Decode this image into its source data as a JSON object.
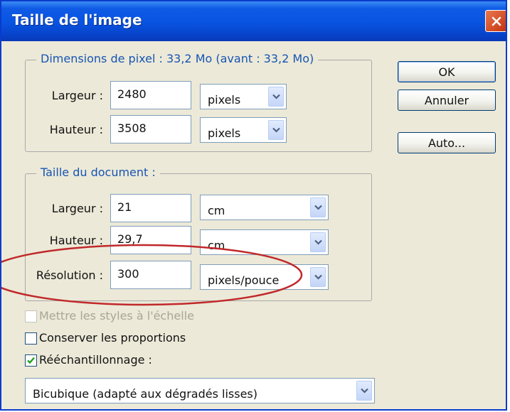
{
  "window": {
    "title": "Taille de l'image"
  },
  "pixel_dimensions": {
    "legend": "Dimensions de pixel :  33,2 Mo (avant : 33,2 Mo)",
    "width": {
      "label": "Largeur :",
      "value": "2480",
      "unit": "pixels"
    },
    "height": {
      "label": "Hauteur :",
      "value": "3508",
      "unit": "pixels"
    }
  },
  "document_size": {
    "legend": "Taille du document :",
    "width": {
      "label": "Largeur :",
      "value": "21",
      "unit": "cm"
    },
    "height": {
      "label": "Hauteur :",
      "value": "29,7",
      "unit": "cm"
    },
    "resolution": {
      "label": "Résolution :",
      "value": "300",
      "unit": "pixels/pouce"
    }
  },
  "buttons": {
    "ok": "OK",
    "cancel": "Annuler",
    "auto": "Auto..."
  },
  "options": {
    "scale_styles": {
      "label": "Mettre les styles à l'échelle",
      "checked": false,
      "enabled": false
    },
    "constrain": {
      "label": "Conserver les proportions",
      "checked": false,
      "enabled": true
    },
    "resample": {
      "label": "Rééchantillonnage :",
      "checked": true,
      "enabled": true
    },
    "resample_method": "Bicubique (adapté aux dégradés lisses)"
  },
  "colors": {
    "title_bar": "#0955e3",
    "legend_text": "#1755b3",
    "dialog_bg": "#ece9d8",
    "highlight": "#c0282a",
    "close_button": "#d9501f"
  },
  "icons": {
    "close": "close-icon",
    "dropdown": "chevron-down-icon",
    "check": "checkmark-icon"
  }
}
